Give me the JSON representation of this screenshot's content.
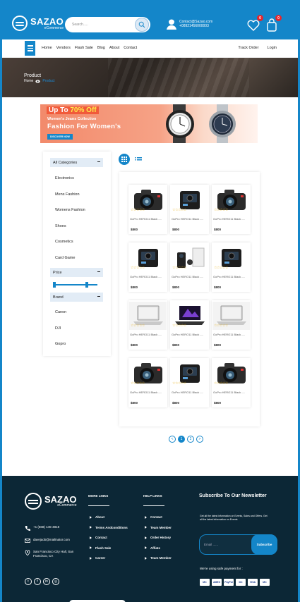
{
  "header": {
    "logo_name": "SAZAO",
    "logo_tag": "eCommerce",
    "search_placeholder": "Search.....",
    "contact_email": "Contact@Sazao.com",
    "contact_phone": "+08921456000003",
    "wishlist_count": "0",
    "cart_count": "0"
  },
  "nav": {
    "links": [
      "Home",
      "Vendors",
      "Flash Sale",
      "Blog",
      "About",
      "Contact"
    ],
    "track_order": "Track Order",
    "login": "Login"
  },
  "hero": {
    "title": "Product",
    "crumb_home": "Home",
    "crumb_current": "Product"
  },
  "banner": {
    "up_to": "Up To ",
    "discount": "70% Off",
    "subtitle": "Women's Jeans Collection",
    "headline": "Fashion For Women's",
    "button": "DISCOVER NOW"
  },
  "sidebar": {
    "categories_title": "All Categories",
    "categories": [
      "Electronics",
      "Mens Fashion",
      "Womens Fashion",
      "Shoes",
      "Cosmetics",
      "Card Game"
    ],
    "price_title": "Price",
    "price_range": {
      "min_fraction": 0.0,
      "max_fraction": 0.75
    },
    "brand_title": "Brand",
    "brands": [
      "Canon",
      "DJI",
      "Gopro"
    ]
  },
  "products": [
    {
      "name": "GoPro HERO11 Black -...",
      "price": "$800",
      "stars": "☆☆☆☆☆",
      "icon": "dslr-camera-icon"
    },
    {
      "name": "GoPro HERO11 Black -...",
      "price": "$800",
      "stars": "☆☆☆☆☆",
      "icon": "action-camera-icon"
    },
    {
      "name": "GoPro HERO11 Black -...",
      "price": "$800",
      "stars": "☆☆☆☆☆",
      "icon": "dslr-camera-icon"
    },
    {
      "name": "GoPro HERO11 Black -...",
      "price": "$800",
      "stars": "☆☆☆☆☆",
      "icon": "action-camera-icon"
    },
    {
      "name": "GoPro HERO11 Black -...",
      "price": "$800",
      "stars": "☆☆☆☆☆",
      "icon": "camera-kit-icon"
    },
    {
      "name": "GoPro HERO11 Black -...",
      "price": "$800",
      "stars": "☆☆☆☆☆",
      "icon": "action-camera-icon"
    },
    {
      "name": "GoPro HERO11 Black -...",
      "price": "$800",
      "stars": "☆☆☆☆☆",
      "icon": "laptop-icon"
    },
    {
      "name": "GoPro HERO11 Black -...",
      "price": "$800",
      "stars": "☆☆☆☆☆",
      "icon": "gaming-laptop-icon"
    },
    {
      "name": "GoPro HERO11 Black -...",
      "price": "$800",
      "stars": "☆☆☆☆☆",
      "icon": "laptop-icon"
    },
    {
      "name": "GoPro HERO11 Black -...",
      "price": "$800",
      "stars": "☆☆☆☆☆",
      "icon": "dslr-camera-icon"
    },
    {
      "name": "GoPro HERO11 Black -...",
      "price": "$800",
      "stars": "☆☆☆☆☆",
      "icon": "action-camera-icon"
    },
    {
      "name": "GoPro HERO11 Black -...",
      "price": "$800",
      "stars": "☆☆☆☆☆",
      "icon": "dslr-camera-icon"
    }
  ],
  "pagination": {
    "prev": "<",
    "pages": [
      "1",
      "2"
    ],
    "active": "1",
    "next": ">"
  },
  "footer": {
    "logo_name": "SAZAO",
    "logo_tag": "eCommerce",
    "phone": "+1 (568) 145-4818",
    "email": "davejaob@mailinator.com",
    "address": "San Francisco City Hall, San Francisco, CA",
    "more_links_title": "MORE LINKS",
    "more_links": [
      "About",
      "Terms Andconditions",
      "Contact",
      "Flash Sale",
      "Career"
    ],
    "help_links_title": "HELP LINKS",
    "help_links": [
      "Contact",
      "Team Member",
      "Order History",
      "Affiate",
      "Team Member"
    ],
    "newsletter_title": "Subscribe To Our Newsletter",
    "newsletter_text": "Get all the latest information on Events, Sales and Offers. Get all the latest information on Events",
    "email_placeholder": "Email ......",
    "subscribe": "Subscribe",
    "payment_text": "We're using safe payment for :",
    "payments": [
      "MC",
      "AMEX",
      "PayPal",
      "DC",
      "VISA",
      "MC"
    ],
    "socials": [
      "twitter-icon",
      "facebook-icon",
      "linkedin-icon",
      "instagram-icon"
    ]
  },
  "colors": {
    "primary": "#1486c9",
    "footer_bg": "#0c2736",
    "badge": "#e8252b",
    "banner_accent": "#f15a3a"
  }
}
